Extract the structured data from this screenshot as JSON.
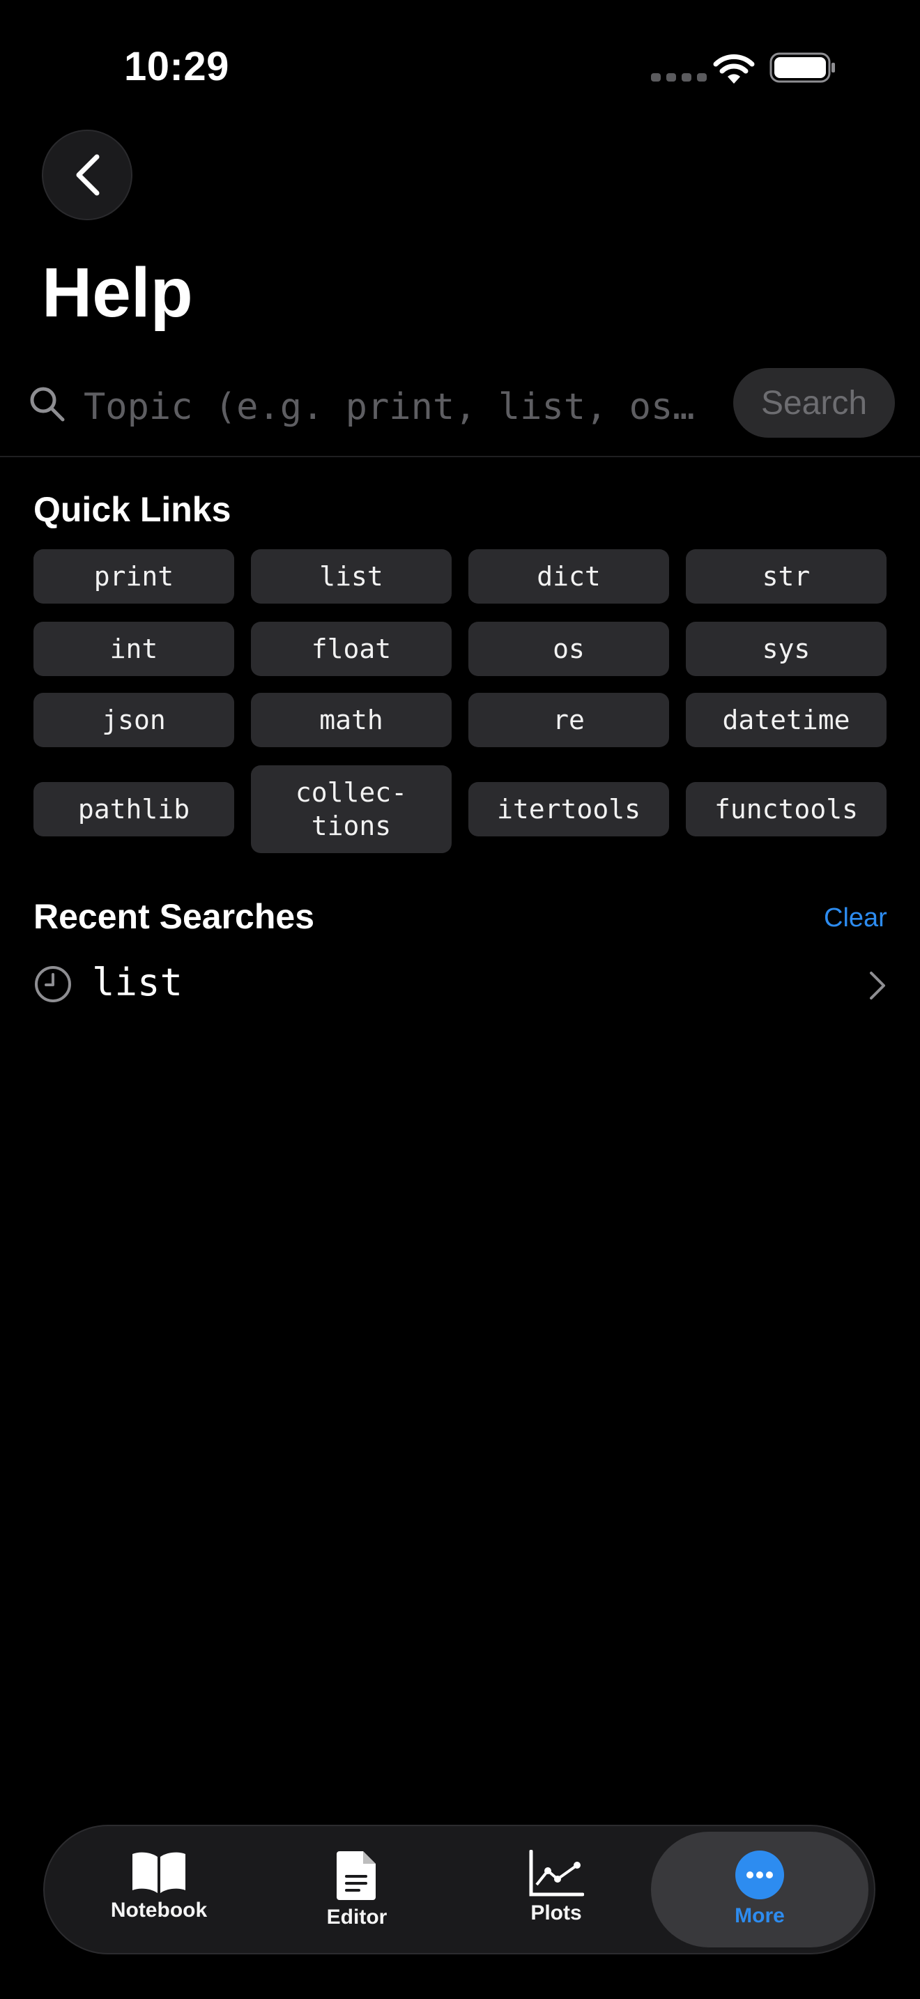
{
  "status_bar": {
    "time": "10:29"
  },
  "header": {
    "title": "Help"
  },
  "search": {
    "placeholder": "Topic (e.g. print, list, os…",
    "button_label": "Search"
  },
  "quick_links": {
    "title": "Quick Links",
    "items": [
      {
        "label": "print"
      },
      {
        "label": "list"
      },
      {
        "label": "dict"
      },
      {
        "label": "str"
      },
      {
        "label": "int"
      },
      {
        "label": "float"
      },
      {
        "label": "os"
      },
      {
        "label": "sys"
      },
      {
        "label": "json"
      },
      {
        "label": "math"
      },
      {
        "label": "re"
      },
      {
        "label": "datetime"
      },
      {
        "label": "pathlib"
      },
      {
        "label": "collec-\ntions"
      },
      {
        "label": "itertools"
      },
      {
        "label": "functools"
      }
    ]
  },
  "recent": {
    "title": "Recent Searches",
    "clear_label": "Clear",
    "items": [
      {
        "label": "list"
      }
    ]
  },
  "tab_bar": {
    "tabs": [
      {
        "label": "Notebook"
      },
      {
        "label": "Editor"
      },
      {
        "label": "Plots"
      },
      {
        "label": "More"
      }
    ]
  },
  "colors": {
    "background": "#000000",
    "accent": "#2d8cf0",
    "chip": "#2b2b2e"
  }
}
